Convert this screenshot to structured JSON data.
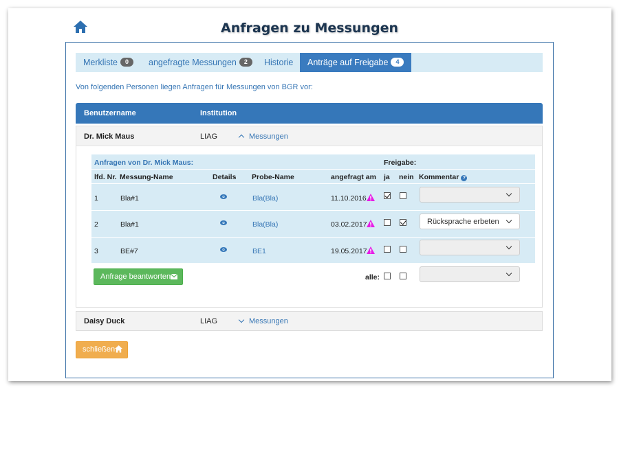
{
  "page": {
    "title": "Anfragen zu Messungen",
    "intro": "Von folgenden Personen liegen Anfragen für Messungen von BGR vor:"
  },
  "tabs": [
    {
      "label": "Merkliste",
      "count": "0"
    },
    {
      "label": "angefragte Messungen",
      "count": "2"
    },
    {
      "label": "Historie",
      "count": ""
    },
    {
      "label": "Anträge auf Freigabe",
      "count": "4"
    }
  ],
  "grid": {
    "col_user": "Benutzername",
    "col_institution": "Institution"
  },
  "persons": [
    {
      "name": "Dr. Mick Maus",
      "institution": "LIAG",
      "toggle": "Messungen"
    },
    {
      "name": "Daisy Duck",
      "institution": "LIAG",
      "toggle": "Messungen"
    }
  ],
  "requests": {
    "title": "Anfragen von Dr. Mick Maus:",
    "freigabe_label": "Freigabe:",
    "columns": {
      "nr": "lfd. Nr.",
      "messung": "Messung-Name",
      "details": "Details",
      "probe": "Probe-Name",
      "date": "angefragt am",
      "ja": "ja",
      "nein": "nein",
      "kommentar": "Kommentar"
    },
    "rows": [
      {
        "nr": "1",
        "messung": "Bla#1",
        "probe": "Bla(Bla)",
        "date": "11.10.2016",
        "ja": true,
        "nein": false,
        "kommentar": ""
      },
      {
        "nr": "2",
        "messung": "Bla#1",
        "probe": "Bla(Bla)",
        "date": "03.02.2017",
        "ja": false,
        "nein": true,
        "kommentar": "Rücksprache erbeten"
      },
      {
        "nr": "3",
        "messung": "BE#7",
        "probe": "BE1",
        "date": "19.05.2017",
        "ja": false,
        "nein": false,
        "kommentar": ""
      }
    ],
    "alle_label": "alle:",
    "submit_label": "Anfrage beantworten"
  },
  "close_label": "schließen",
  "colors": {
    "primary": "#3577b9",
    "light_blue": "#d7ebf5",
    "green": "#5cb85c",
    "orange": "#f0ad4e",
    "warning": "#e61ee6"
  }
}
